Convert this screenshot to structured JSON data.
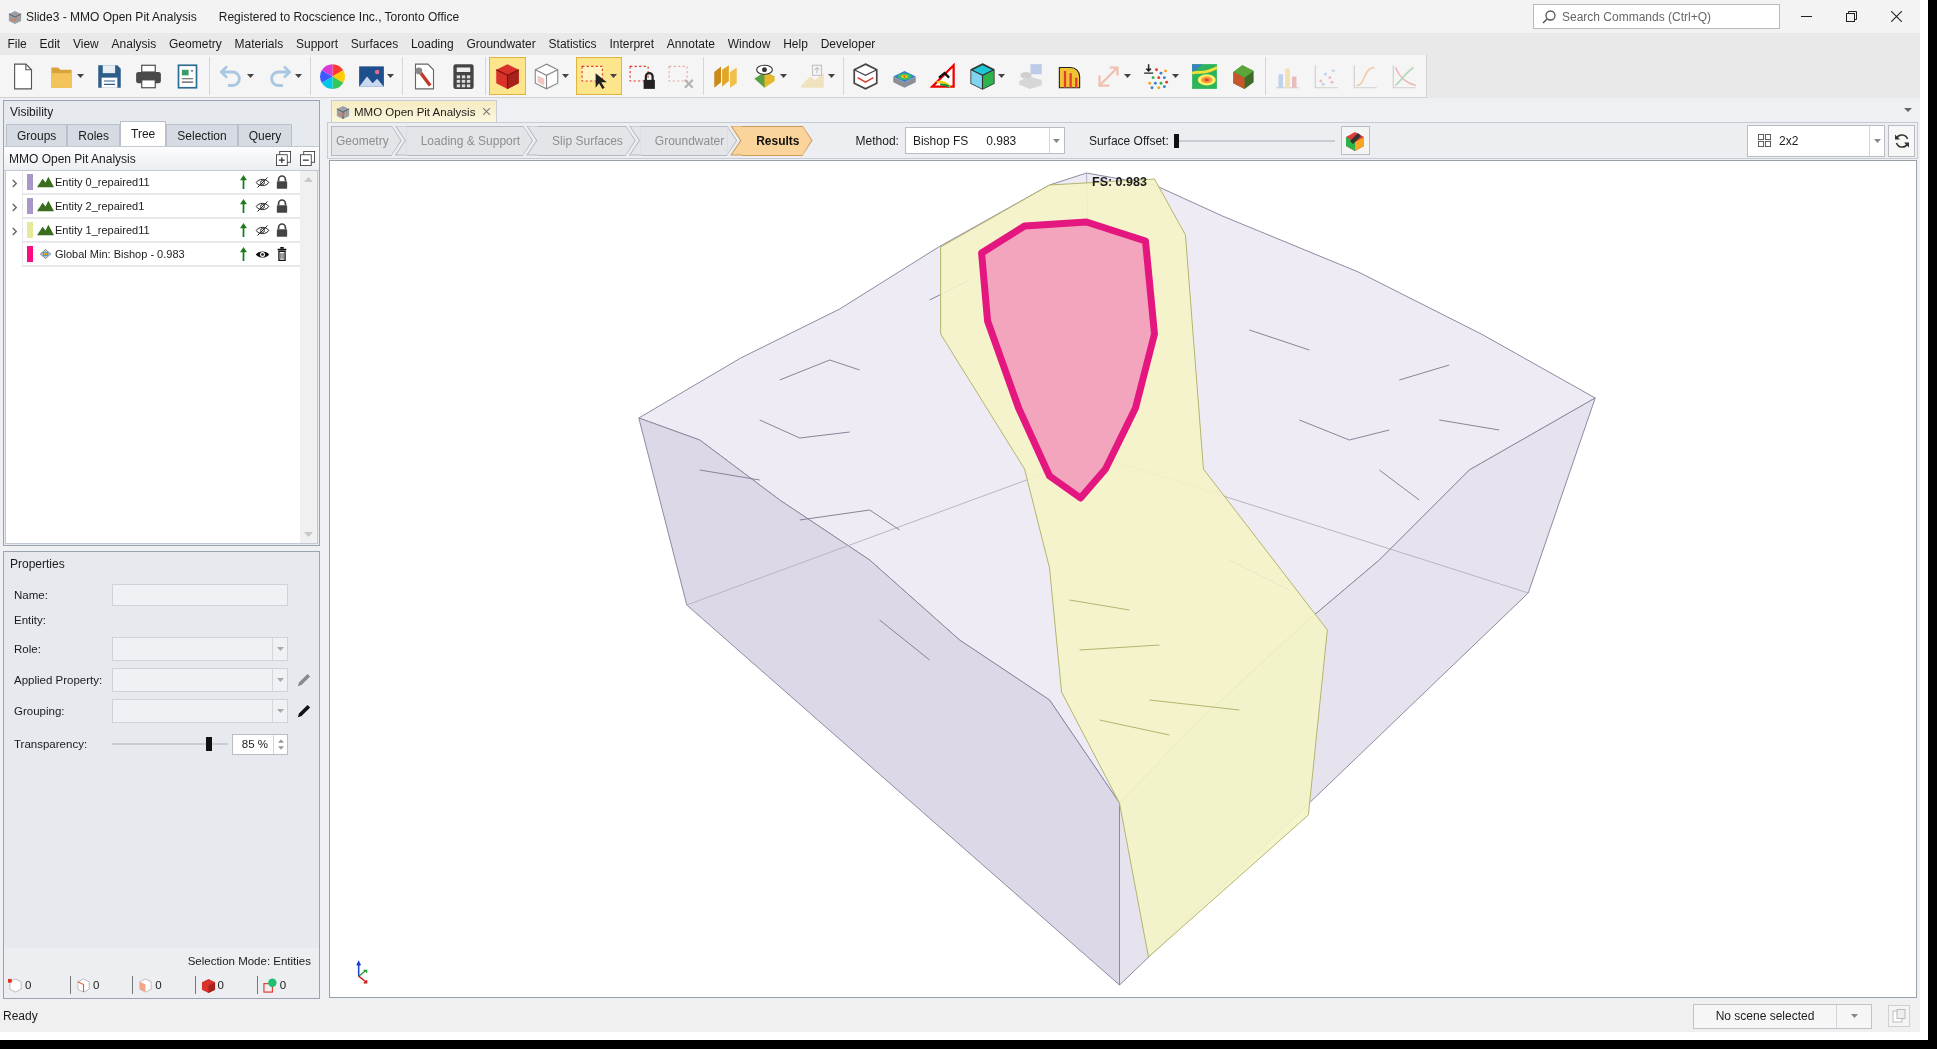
{
  "window": {
    "title": "Slide3 - MMO Open Pit Analysis",
    "registration": "Registered to Rocscience Inc., Toronto Office"
  },
  "search": {
    "placeholder": "Search Commands (Ctrl+Q)"
  },
  "menu": [
    "File",
    "Edit",
    "View",
    "Analysis",
    "Geometry",
    "Materials",
    "Support",
    "Surfaces",
    "Loading",
    "Groundwater",
    "Statistics",
    "Interpret",
    "Annotate",
    "Window",
    "Help",
    "Developer"
  ],
  "toolbar": [
    [
      {
        "selected": false,
        "disabled": false,
        "menu": false
      },
      {
        "selected": false,
        "disabled": false,
        "menu": true
      },
      {
        "selected": false,
        "disabled": false,
        "menu": false
      },
      {
        "selected": false,
        "disabled": false,
        "menu": false
      },
      {
        "selected": false,
        "disabled": false,
        "menu": false
      }
    ],
    [
      {
        "selected": false,
        "disabled": true,
        "menu": true
      },
      {
        "selected": false,
        "disabled": true,
        "menu": true
      }
    ],
    [
      {
        "selected": false,
        "disabled": false,
        "menu": false
      },
      {
        "selected": false,
        "disabled": false,
        "menu": true
      }
    ],
    [
      {
        "selected": false,
        "disabled": false,
        "menu": false
      },
      {
        "selected": false,
        "disabled": false,
        "menu": false
      }
    ],
    [
      {
        "selected": true,
        "disabled": false,
        "menu": false
      },
      {
        "selected": false,
        "disabled": false,
        "menu": true
      },
      {
        "selected": true,
        "disabled": false,
        "menu": true
      },
      {
        "selected": false,
        "disabled": false,
        "menu": false
      },
      {
        "selected": false,
        "disabled": true,
        "menu": false
      }
    ],
    [
      {
        "selected": false,
        "disabled": false,
        "menu": false
      },
      {
        "selected": false,
        "disabled": false,
        "menu": true
      },
      {
        "selected": false,
        "disabled": true,
        "menu": true
      }
    ],
    [
      {
        "selected": false,
        "disabled": false,
        "menu": false
      },
      {
        "selected": false,
        "disabled": false,
        "menu": false
      },
      {
        "selected": false,
        "disabled": false,
        "menu": false
      },
      {
        "selected": false,
        "disabled": false,
        "menu": true
      },
      {
        "selected": false,
        "disabled": true,
        "menu": false
      },
      {
        "selected": false,
        "disabled": false,
        "menu": false
      },
      {
        "selected": false,
        "disabled": true,
        "menu": true
      },
      {
        "selected": false,
        "disabled": false,
        "menu": true
      },
      {
        "selected": false,
        "disabled": false,
        "menu": false
      },
      {
        "selected": false,
        "disabled": false,
        "menu": false
      }
    ],
    [
      {
        "selected": false,
        "disabled": true,
        "menu": false
      },
      {
        "selected": false,
        "disabled": true,
        "menu": false
      },
      {
        "selected": false,
        "disabled": true,
        "menu": false
      },
      {
        "selected": false,
        "disabled": true,
        "menu": false
      }
    ]
  ],
  "visibility": {
    "title": "Visibility",
    "tabs": [
      {
        "label": "Groups",
        "selected": false
      },
      {
        "label": "Roles",
        "selected": false
      },
      {
        "label": "Tree",
        "selected": true
      },
      {
        "label": "Selection",
        "selected": false
      },
      {
        "label": "Query",
        "selected": false
      }
    ],
    "tree": {
      "title": "MMO Open Pit Analysis",
      "items": [
        {
          "kind": "entity",
          "label": "Entity 0_repaired11",
          "color": "#a898c8",
          "expanded": false,
          "visible": false,
          "locked": true
        },
        {
          "kind": "entity",
          "label": "Entity 2_repaired1",
          "color": "#a898c8",
          "expanded": false,
          "visible": false,
          "locked": true
        },
        {
          "kind": "entity",
          "label": "Entity 1_repaired11",
          "color": "#e4ea98",
          "expanded": false,
          "visible": false,
          "locked": true
        },
        {
          "kind": "result",
          "label": "Global Min: Bishop - 0.983",
          "color": "#ff0a80",
          "visible": true
        }
      ]
    }
  },
  "properties": {
    "title": "Properties",
    "fields": [
      {
        "kind": "text",
        "label": "Name:",
        "disabled": true
      },
      {
        "kind": "label",
        "label": "Entity:"
      },
      {
        "kind": "dropdown",
        "label": "Role:",
        "disabled": true
      },
      {
        "kind": "dropdown",
        "label": "Applied Property:",
        "disabled": true,
        "pencil": {
          "disabled": true
        }
      },
      {
        "kind": "dropdown",
        "label": "Grouping:",
        "disabled": true,
        "pencil": {
          "disabled": false
        }
      }
    ],
    "transparency": {
      "label": "Transparency:",
      "level": 0.85,
      "value": "85 %"
    },
    "selection_mode": "Selection Mode: Entities",
    "selection_counts": [
      "0",
      "0",
      "0",
      "0",
      "0"
    ]
  },
  "document_tabs": [
    {
      "label": "MMO Open Pit Analysis",
      "selected": true
    }
  ],
  "workflow": [
    {
      "label": "Geometry",
      "selected": false
    },
    {
      "label": "Loading & Support",
      "selected": false
    },
    {
      "label": "Slip Surfaces",
      "selected": false
    },
    {
      "label": "Groundwater",
      "selected": false
    },
    {
      "label": "Results",
      "selected": true
    }
  ],
  "method": {
    "label": "Method:",
    "option": "Bishop FS",
    "factor": "0.983"
  },
  "surface_offset": {
    "label": "Surface Offset:",
    "level": 0
  },
  "layout": {
    "value": "2x2"
  },
  "viewport": {
    "annotation": "FS: 0.983"
  },
  "status_bar": {
    "text": "Ready",
    "scene": "No scene selected"
  }
}
